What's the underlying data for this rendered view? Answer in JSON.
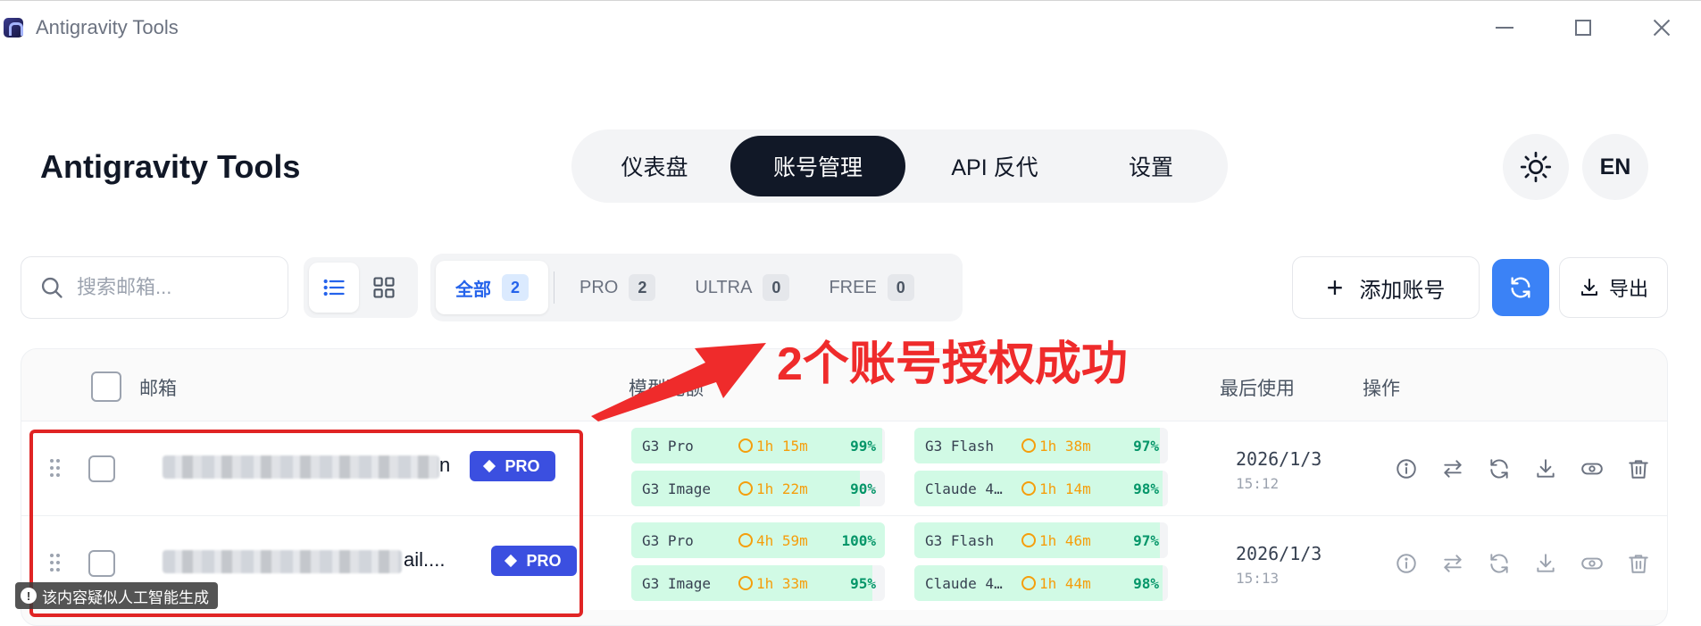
{
  "window": {
    "title": "Antigravity Tools"
  },
  "brand": "Antigravity Tools",
  "nav": {
    "tabs": [
      {
        "label": "仪表盘",
        "active": false
      },
      {
        "label": "账号管理",
        "active": true
      },
      {
        "label": "API 反代",
        "active": false
      },
      {
        "label": "设置",
        "active": false
      }
    ]
  },
  "header_actions": {
    "theme_icon": "sun-icon",
    "language": "EN"
  },
  "search": {
    "placeholder": "搜索邮箱...",
    "value": ""
  },
  "view_modes": [
    {
      "name": "list-view-icon",
      "active": true
    },
    {
      "name": "grid-view-icon",
      "active": false
    }
  ],
  "filters": [
    {
      "label": "全部",
      "count": "2",
      "active": true
    },
    {
      "label": "PRO",
      "count": "2",
      "active": false
    },
    {
      "label": "ULTRA",
      "count": "0",
      "active": false
    },
    {
      "label": "FREE",
      "count": "0",
      "active": false
    }
  ],
  "toolbar": {
    "add_label": "添加账号",
    "export_label": "导出",
    "accent": "#3b82f6"
  },
  "table": {
    "headers": {
      "email": "邮箱",
      "quota": "模型配额",
      "last_used": "最后使用",
      "actions": "操作"
    },
    "rows": [
      {
        "email_visible_tail": "n",
        "plan": "PRO",
        "quotas": [
          {
            "model": "G3 Pro",
            "reset": "1h 15m",
            "percent": "99%",
            "fill": 0.99
          },
          {
            "model": "G3 Flash",
            "reset": "1h 38m",
            "percent": "97%",
            "fill": 0.97
          },
          {
            "model": "G3 Image",
            "reset": "1h 22m",
            "percent": "90%",
            "fill": 0.9
          },
          {
            "model": "Claude 4…",
            "reset": "1h 14m",
            "percent": "98%",
            "fill": 0.98
          }
        ],
        "last_used_date": "2026/1/3",
        "last_used_time": "15:12"
      },
      {
        "email_visible_tail": "ail....",
        "plan": "PRO",
        "quotas": [
          {
            "model": "G3 Pro",
            "reset": "4h 59m",
            "percent": "100%",
            "fill": 1.0
          },
          {
            "model": "G3 Flash",
            "reset": "1h 46m",
            "percent": "97%",
            "fill": 0.97
          },
          {
            "model": "G3 Image",
            "reset": "1h 33m",
            "percent": "95%",
            "fill": 0.95
          },
          {
            "model": "Claude 4…",
            "reset": "1h 44m",
            "percent": "98%",
            "fill": 0.98
          }
        ],
        "last_used_date": "2026/1/3",
        "last_used_time": "15:13"
      }
    ],
    "row_actions": [
      "info-icon",
      "switch-icon",
      "refresh-icon",
      "download-icon",
      "eye-icon",
      "trash-icon"
    ]
  },
  "annotation": {
    "text": "2个账号授权成功",
    "color": "#ef2b2b"
  },
  "ai_notice": "该内容疑似人工智能生成"
}
